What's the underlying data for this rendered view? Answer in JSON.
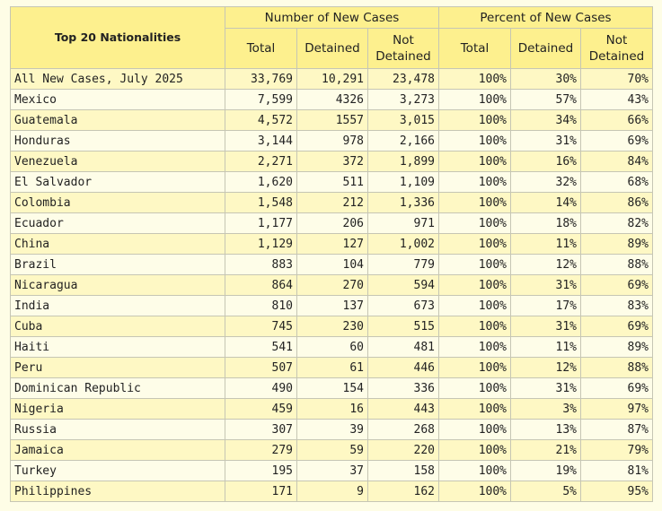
{
  "headers": {
    "title": "Top 20 Nationalities",
    "group_number": "Number of New Cases",
    "group_percent": "Percent of New Cases",
    "cols": [
      "Total",
      "Detained",
      "Not Detained",
      "Total",
      "Detained",
      "Not Detained"
    ]
  },
  "rows": [
    {
      "name": "All New Cases, July 2025",
      "total": "33,769",
      "detained": "10,291",
      "not_detained": "23,478",
      "pct_total": "100%",
      "pct_detained": "30%",
      "pct_not_detained": "70%"
    },
    {
      "name": "Mexico",
      "total": "7,599",
      "detained": "4326",
      "not_detained": "3,273",
      "pct_total": "100%",
      "pct_detained": "57%",
      "pct_not_detained": "43%"
    },
    {
      "name": "Guatemala",
      "total": "4,572",
      "detained": "1557",
      "not_detained": "3,015",
      "pct_total": "100%",
      "pct_detained": "34%",
      "pct_not_detained": "66%"
    },
    {
      "name": "Honduras",
      "total": "3,144",
      "detained": "978",
      "not_detained": "2,166",
      "pct_total": "100%",
      "pct_detained": "31%",
      "pct_not_detained": "69%"
    },
    {
      "name": "Venezuela",
      "total": "2,271",
      "detained": "372",
      "not_detained": "1,899",
      "pct_total": "100%",
      "pct_detained": "16%",
      "pct_not_detained": "84%"
    },
    {
      "name": "El Salvador",
      "total": "1,620",
      "detained": "511",
      "not_detained": "1,109",
      "pct_total": "100%",
      "pct_detained": "32%",
      "pct_not_detained": "68%"
    },
    {
      "name": "Colombia",
      "total": "1,548",
      "detained": "212",
      "not_detained": "1,336",
      "pct_total": "100%",
      "pct_detained": "14%",
      "pct_not_detained": "86%"
    },
    {
      "name": "Ecuador",
      "total": "1,177",
      "detained": "206",
      "not_detained": "971",
      "pct_total": "100%",
      "pct_detained": "18%",
      "pct_not_detained": "82%"
    },
    {
      "name": "China",
      "total": "1,129",
      "detained": "127",
      "not_detained": "1,002",
      "pct_total": "100%",
      "pct_detained": "11%",
      "pct_not_detained": "89%"
    },
    {
      "name": "Brazil",
      "total": "883",
      "detained": "104",
      "not_detained": "779",
      "pct_total": "100%",
      "pct_detained": "12%",
      "pct_not_detained": "88%"
    },
    {
      "name": "Nicaragua",
      "total": "864",
      "detained": "270",
      "not_detained": "594",
      "pct_total": "100%",
      "pct_detained": "31%",
      "pct_not_detained": "69%"
    },
    {
      "name": "India",
      "total": "810",
      "detained": "137",
      "not_detained": "673",
      "pct_total": "100%",
      "pct_detained": "17%",
      "pct_not_detained": "83%"
    },
    {
      "name": "Cuba",
      "total": "745",
      "detained": "230",
      "not_detained": "515",
      "pct_total": "100%",
      "pct_detained": "31%",
      "pct_not_detained": "69%"
    },
    {
      "name": "Haiti",
      "total": "541",
      "detained": "60",
      "not_detained": "481",
      "pct_total": "100%",
      "pct_detained": "11%",
      "pct_not_detained": "89%"
    },
    {
      "name": "Peru",
      "total": "507",
      "detained": "61",
      "not_detained": "446",
      "pct_total": "100%",
      "pct_detained": "12%",
      "pct_not_detained": "88%"
    },
    {
      "name": "Dominican Republic",
      "total": "490",
      "detained": "154",
      "not_detained": "336",
      "pct_total": "100%",
      "pct_detained": "31%",
      "pct_not_detained": "69%"
    },
    {
      "name": "Nigeria",
      "total": "459",
      "detained": "16",
      "not_detained": "443",
      "pct_total": "100%",
      "pct_detained": "3%",
      "pct_not_detained": "97%"
    },
    {
      "name": "Russia",
      "total": "307",
      "detained": "39",
      "not_detained": "268",
      "pct_total": "100%",
      "pct_detained": "13%",
      "pct_not_detained": "87%"
    },
    {
      "name": "Jamaica",
      "total": "279",
      "detained": "59",
      "not_detained": "220",
      "pct_total": "100%",
      "pct_detained": "21%",
      "pct_not_detained": "79%"
    },
    {
      "name": "Turkey",
      "total": "195",
      "detained": "37",
      "not_detained": "158",
      "pct_total": "100%",
      "pct_detained": "19%",
      "pct_not_detained": "81%"
    },
    {
      "name": "Philippines",
      "total": "171",
      "detained": "9",
      "not_detained": "162",
      "pct_total": "100%",
      "pct_detained": "5%",
      "pct_not_detained": "95%"
    }
  ],
  "colors": {
    "header_bg": "#fdf08e",
    "row_odd_bg": "#fef8c4",
    "row_even_bg": "#fefde8",
    "border": "#c6c6b4",
    "page_bg": "#fefde6"
  }
}
